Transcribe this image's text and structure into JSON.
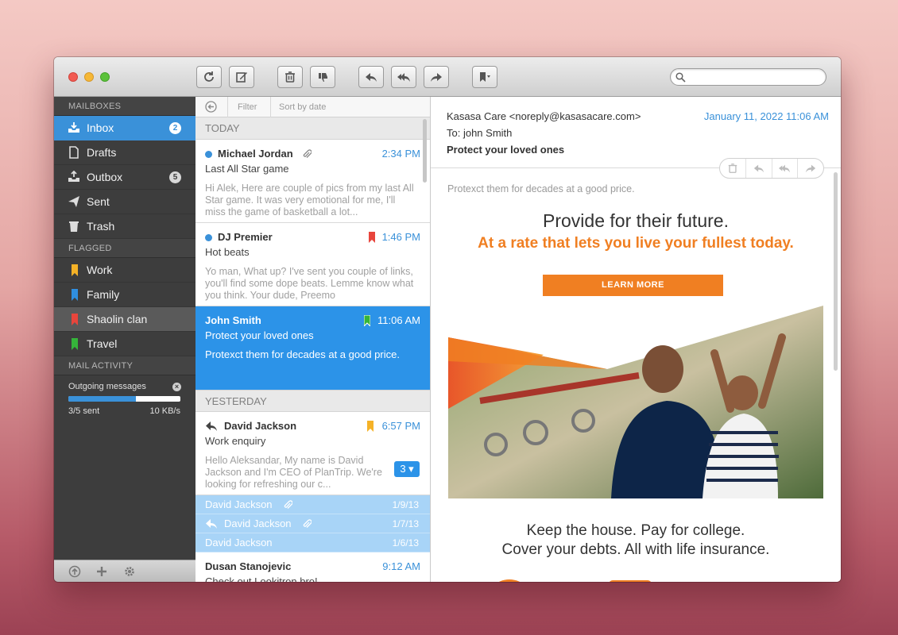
{
  "toolbar": {
    "buttons": [
      "refresh",
      "compose",
      "delete",
      "spam",
      "reply",
      "reply-all",
      "forward",
      "tag"
    ],
    "search_placeholder": ""
  },
  "sidebar": {
    "mailboxes_header": "MAILBOXES",
    "mailboxes": [
      {
        "label": "Inbox",
        "badge": "2",
        "icon": "inbox-icon"
      },
      {
        "label": "Drafts",
        "badge": "",
        "icon": "draft-icon"
      },
      {
        "label": "Outbox",
        "badge": "5",
        "icon": "outbox-icon"
      },
      {
        "label": "Sent",
        "badge": "",
        "icon": "paper-plane-icon"
      },
      {
        "label": "Trash",
        "badge": "",
        "icon": "trash-icon"
      }
    ],
    "flagged_header": "FLAGGED",
    "flagged": [
      {
        "label": "Work",
        "color": "#f5b227"
      },
      {
        "label": "Family",
        "color": "#2f8fe0"
      },
      {
        "label": "Shaolin clan",
        "color": "#e8453c"
      },
      {
        "label": "Travel",
        "color": "#35b53a"
      }
    ],
    "activity_header": "MAIL ACTIVITY",
    "activity": {
      "title": "Outgoing messages",
      "progress": 0.6,
      "sent": "3/5 sent",
      "speed": "10 KB/s"
    }
  },
  "list": {
    "filter_label": "Filter",
    "sort_label": "Sort by date",
    "today_header": "TODAY",
    "yesterday_header": "YESTERDAY",
    "today": [
      {
        "from": "Michael Jordan",
        "time": "2:34 PM",
        "subject": "Last All Star game",
        "preview": "Hi Alek, Here are couple of pics from my last All Star game. It was very emotional for me, I'll miss the game of basketball a lot..."
      },
      {
        "from": "DJ Premier",
        "time": "1:46 PM",
        "subject": "Hot beats",
        "preview": "Yo man, What up? I've sent you couple of links, you'll find some dope beats. Lemme know what you think. Your dude, Preemo"
      },
      {
        "from": "John Smith",
        "time": "11:06 AM",
        "subject": "Protect your loved ones",
        "preview": "Protexct them for decades at a good price."
      }
    ],
    "yesterday": [
      {
        "from": "David Jackson",
        "time": "6:57 PM",
        "subject": "Work enquiry",
        "preview": "Hello Aleksandar, My name is David Jackson and I'm CEO of PlanTrip. We're looking for refreshing our c...",
        "thread_count": "3"
      }
    ],
    "thread": [
      {
        "from": "David Jackson",
        "date": "1/9/13"
      },
      {
        "from": "David Jackson",
        "date": "1/7/13"
      },
      {
        "from": "David Jackson",
        "date": "1/6/13"
      }
    ],
    "last": {
      "from": "Dusan Stanojevic",
      "time": "9:12 AM",
      "subject": "Check out Lookitron bro!"
    }
  },
  "reader": {
    "from": "Kasasa Care <noreply@kasasacare.com>",
    "date": "January 11, 2022 11:06 AM",
    "to": "To: john Smith",
    "subject": "Protect your loved ones",
    "preheader": "Protexct them for decades at a good price.",
    "headline": "Provide for their future.",
    "subheadline": "At a rate that lets you live your fullest today.",
    "cta": "LEARN MORE",
    "keep_line1": "Keep the house. Pay for college.",
    "keep_line2": "Cover your debts. All with life insurance.",
    "accent": "#f07f22"
  }
}
